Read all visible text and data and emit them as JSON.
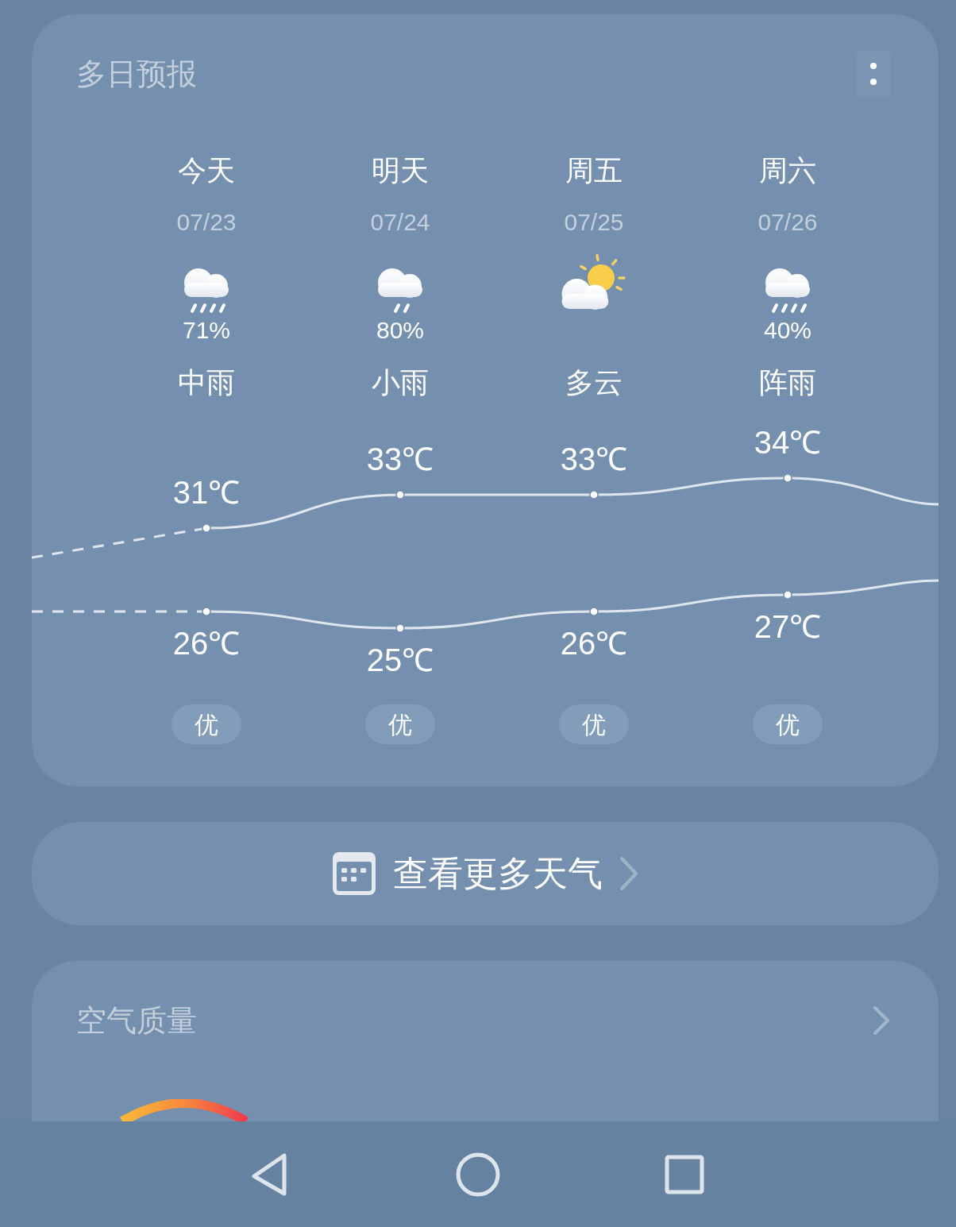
{
  "forecast": {
    "title": "多日预报",
    "days": [
      {
        "day": "今天",
        "date": "07/23",
        "kind": "rain4",
        "precip": "71%",
        "condition": "中雨",
        "high": "31℃",
        "low": "26℃",
        "aqi": "优"
      },
      {
        "day": "明天",
        "date": "07/24",
        "kind": "rain2",
        "precip": "80%",
        "condition": "小雨",
        "high": "33℃",
        "low": "25℃",
        "aqi": "优"
      },
      {
        "day": "周五",
        "date": "07/25",
        "kind": "sun_cloud",
        "condition": "多云",
        "high": "33℃",
        "low": "26℃",
        "aqi": "优"
      },
      {
        "day": "周六",
        "date": "07/26",
        "kind": "rain4",
        "precip": "40%",
        "condition": "阵雨",
        "high": "34℃",
        "low": "27℃",
        "aqi": "优"
      }
    ]
  },
  "more_button": {
    "label": "查看更多天气"
  },
  "air_quality": {
    "title": "空气质量"
  }
}
